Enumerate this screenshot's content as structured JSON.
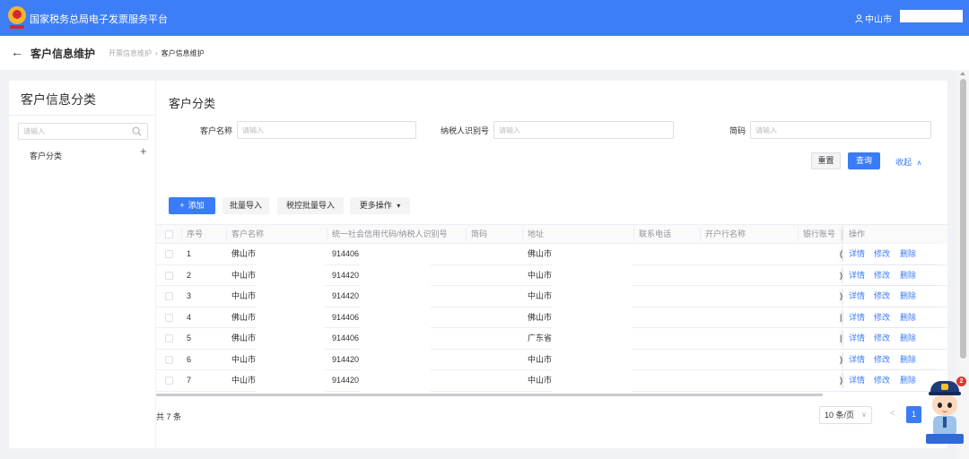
{
  "header": {
    "title": "国家税务总局电子发票服务平台",
    "logo_icon": "tax-emblem-icon",
    "user_icon": "user-icon",
    "user_region": "中山市"
  },
  "breadcrumb": {
    "back_icon": "←",
    "page_title": "客户信息维护",
    "items": [
      "开票信息维护",
      "客户信息维护"
    ],
    "separator": "›"
  },
  "left_panel": {
    "title": "客户信息分类",
    "search_placeholder": "请输入",
    "search_icon": "search-icon",
    "tree": [
      {
        "label": "客户分类",
        "add_icon": "+"
      }
    ]
  },
  "main": {
    "title": "客户分类",
    "filters": {
      "customer_name": {
        "label": "客户名称",
        "placeholder": "请输入",
        "value": ""
      },
      "taxpayer_id": {
        "label": "纳税人识别号",
        "placeholder": "请输入",
        "value": ""
      },
      "short_code": {
        "label": "简码",
        "placeholder": "请输入",
        "value": ""
      }
    },
    "actions": {
      "reset": "重置",
      "query": "查询",
      "collapse": "收起",
      "collapse_icon": "∧"
    },
    "toolbar": {
      "add_icon": "+",
      "add": "添加",
      "batch_import": "批量导入",
      "tax_batch_import": "税控批量导入",
      "more": "更多操作",
      "more_icon": "▾"
    },
    "table": {
      "columns": [
        "序号",
        "客户名称",
        "统一社会信用代码/纳税人识别号",
        "简码",
        "地址",
        "联系电话",
        "开户行名称",
        "银行账号",
        "操作"
      ],
      "row_actions": [
        "详情",
        "修改",
        "删除"
      ],
      "rows": [
        {
          "index": "1",
          "name": "佛山市",
          "code": "914406",
          "short_code": "",
          "address": "佛山市",
          "phone": "",
          "bank_name": "",
          "bank_account": "("
        },
        {
          "index": "2",
          "name": "中山市",
          "code": "914420",
          "short_code": "",
          "address": "中山市",
          "phone": "",
          "bank_name": "",
          "bank_account": ")"
        },
        {
          "index": "3",
          "name": "中山市",
          "code": "914420",
          "short_code": "",
          "address": "中山市",
          "phone": "",
          "bank_name": "",
          "bank_account": ")"
        },
        {
          "index": "4",
          "name": "佛山市",
          "code": "914406",
          "short_code": "",
          "address": "佛山市",
          "phone": "",
          "bank_name": "",
          "bank_account": "|"
        },
        {
          "index": "5",
          "name": "佛山市",
          "code": "914406",
          "short_code": "",
          "address": "广东省",
          "phone": "",
          "bank_name": "",
          "bank_account": "|"
        },
        {
          "index": "6",
          "name": "中山市",
          "code": "914420",
          "short_code": "",
          "address": "中山市",
          "phone": "",
          "bank_name": "",
          "bank_account": ")"
        },
        {
          "index": "7",
          "name": "中山市",
          "code": "914420",
          "short_code": "",
          "address": "中山市",
          "phone": "",
          "bank_name": "",
          "bank_account": ")"
        }
      ]
    },
    "footer": {
      "total": "共 7 条",
      "page_size": "10 条/页",
      "page_size_icon": "∨",
      "prev_icon": "<",
      "current_page": "1"
    }
  },
  "assistant": {
    "icon": "tax-assistant-mascot-icon",
    "badge_count": "2"
  },
  "colors": {
    "header_bg": "#3d7ef6",
    "primary": "#3a7cf6",
    "page_bg": "#f0f2f5",
    "badge": "#e8322e"
  }
}
